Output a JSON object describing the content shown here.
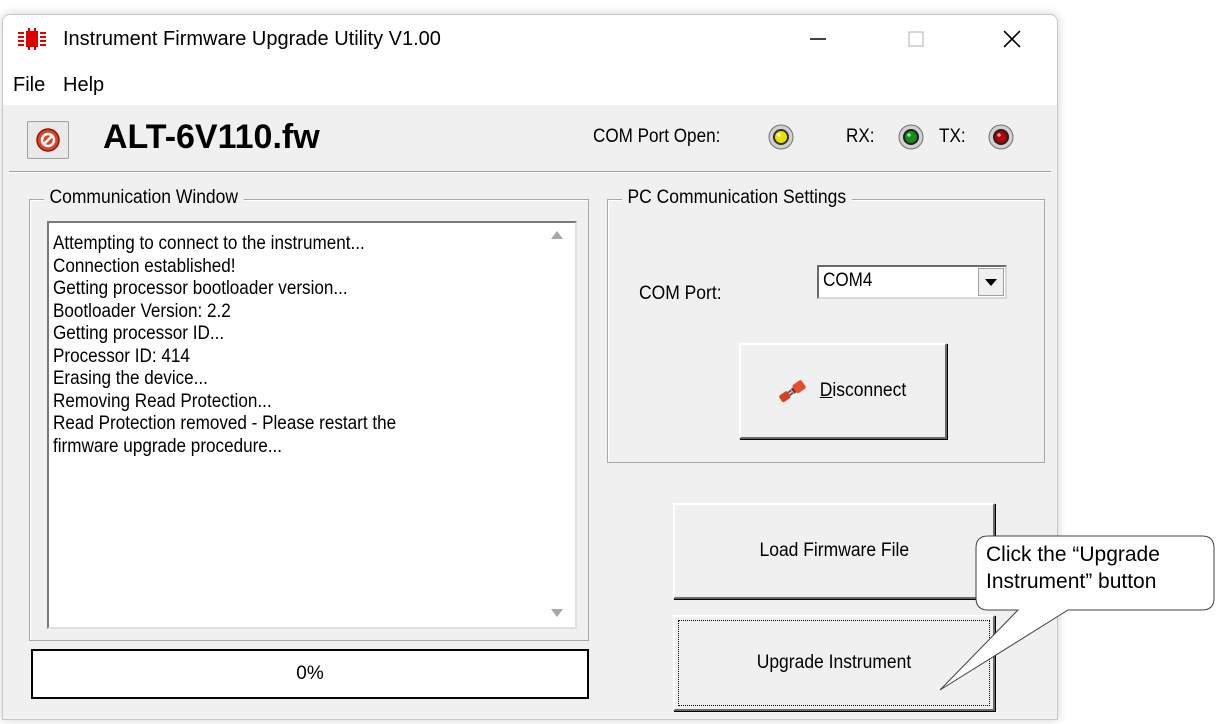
{
  "window": {
    "title": "Instrument Firmware Upgrade Utility V1.00",
    "controls": {
      "minimize": "—",
      "maximize": "☐",
      "close": "✕"
    }
  },
  "menu": {
    "items": [
      "File",
      "Help"
    ]
  },
  "header": {
    "firmware_name": "ALT-6V110.fw",
    "com_port_open_label": "COM Port Open:",
    "rx_label": "RX:",
    "tx_label": "TX:",
    "led_colors": {
      "com": "#e8e000",
      "rx": "#1a8a1a",
      "tx": "#b00000"
    }
  },
  "communication": {
    "title": "Communication Window",
    "lines": [
      "Attempting to connect to the instrument...",
      "Connection established!",
      "Getting processor bootloader version...",
      "Bootloader Version: 2.2",
      "Getting processor ID...",
      "Processor ID: 414",
      "Erasing the device...",
      "Removing Read Protection...",
      "Read Protection removed - Please restart the",
      "firmware upgrade procedure..."
    ]
  },
  "progress": {
    "value": 0,
    "text": "0%"
  },
  "pc_settings": {
    "title": "PC Communication Settings",
    "com_port_label": "COM Port:",
    "com_port_value": "COM4",
    "disconnect_prefix": "D",
    "disconnect_rest": "isconnect"
  },
  "buttons": {
    "load_firmware": "Load Firmware File",
    "upgrade": "Upgrade Instrument"
  },
  "callout": {
    "line1": "Click the “Upgrade",
    "line2": "Instrument” button"
  }
}
